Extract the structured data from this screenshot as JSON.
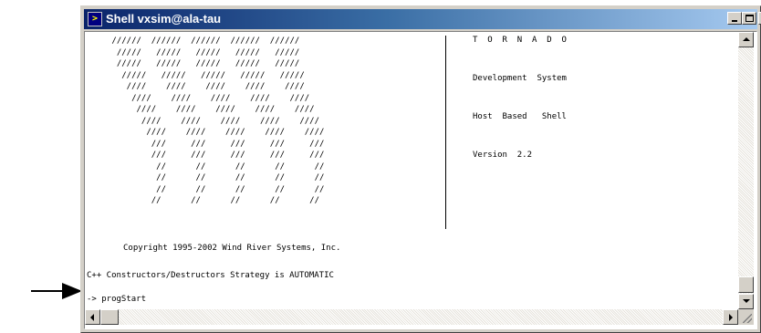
{
  "window": {
    "title": "Shell vxsim@ala-tau",
    "icon": "terminal-prompt-icon",
    "controls": {
      "minimize": "minimize-icon",
      "maximize": "maximize-icon",
      "close_label": "×"
    }
  },
  "terminal": {
    "logo_ascii": " //////  //////  //////  //////  //////\n  /////   /////   /////   /////   /////\n  /////   /////   /////   /////   /////\n   /////   /////   /////   /////   /////\n    ////    ////    ////    ////    ////\n     ////    ////    ////    ////    ////\n      ////    ////    ////    ////    ////\n       ////    ////    ////    ////    ////\n        ////    ////    ////    ////    ////\n         ///     ///     ///     ///     ///\n         ///     ///     ///     ///     ///\n          //      //      //      //      //\n          //      //      //      //      //\n          //      //      //      //      //\n         //      //      //      //      //",
    "info_lines": [
      "T  O  R  N  A  D  O",
      "Development  System",
      "Host  Based   Shell",
      "Version  2.2"
    ],
    "copyright": "Copyright 1995-2002 Wind River Systems, Inc.",
    "constructors": "C++ Constructors/Destructors Strategy is AUTOMATIC",
    "prompt": "-> progStart"
  }
}
